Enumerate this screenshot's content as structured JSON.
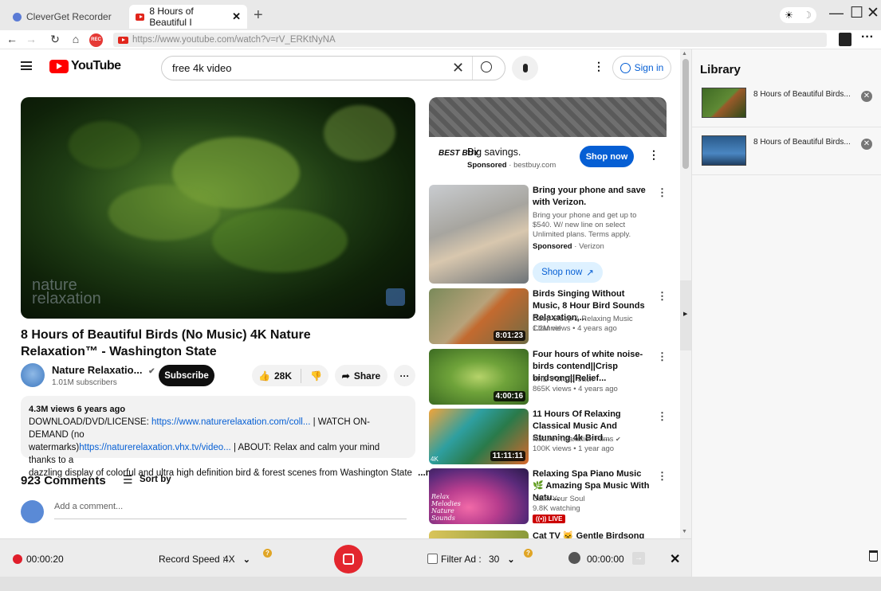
{
  "browser": {
    "tabs": [
      {
        "label": "CleverGet Recorder"
      },
      {
        "label": "8 Hours of Beautiful I"
      }
    ],
    "new_tab": "+",
    "url": "https://www.youtube.com/watch?v=rV_ERKtNyNA",
    "rec_badge": "REC",
    "window_controls": {
      "minimize": "—",
      "maximize": "☐",
      "close": "✕"
    }
  },
  "youtube": {
    "logo": "YouTube",
    "search_query": "free 4k video",
    "signin": "Sign in",
    "video": {
      "title": "8 Hours of Beautiful Birds (No Music) 4K Nature Relaxation™ - Washington State",
      "watermark_line1": "nature",
      "watermark_line2": "relaxation",
      "channel": "Nature Relaxatio...",
      "subscribers": "1.01M subscribers",
      "subscribe": "Subscribe",
      "likes": "28K",
      "share": "Share",
      "description": {
        "stats": "4.3M views  6 years ago",
        "line1_pre": "DOWNLOAD/DVD/LICENSE: ",
        "line1_link": "https://www.naturerelaxation.com/coll...",
        "line1_post": " | WATCH ON-DEMAND (no",
        "line2_pre": "watermarks)",
        "line2_link": "https://naturerelaxation.vhx.tv/video...",
        "line2_post": " | ABOUT: Relax and calm your mind thanks to a",
        "line3": "dazzling display of colorful and ultra high definition bird & forest scenes from Washington State",
        "more": "...more"
      }
    },
    "comments": {
      "count": "923 Comments",
      "sort": "Sort by",
      "placeholder": "Add a comment..."
    },
    "ad": {
      "brand": "BEST BUY",
      "headline": "Big savings.",
      "sponsored": "Sponsored",
      "domain": "bestbuy.com",
      "cta": "Shop now"
    },
    "recommendations": [
      {
        "title": "Bring your phone and save with Verizon.",
        "meta1": "Bring your phone and get up to $540. W/ new line on select Unlimited plans. Terms apply.",
        "sponsored": "Sponsored",
        "advertiser": "Verizon",
        "cta": "Shop now"
      },
      {
        "title": "Birds Singing Without Music, 8 Hour Bird Sounds Relaxation,...",
        "channel": "Deep Sleep & Relaxing Music Channel",
        "stats": "1.2M views  •  4 years ago",
        "duration": "8:01:23"
      },
      {
        "title": "Four hours of white noise-birds contend||Crisp birdsong||Relief...",
        "channel": "THE VOICE -Jack",
        "stats": "865K views  •  4 years ago",
        "duration": "4:00:16"
      },
      {
        "title": "11 Hours Of Relaxing Classical Music And Stunning 4k Bird...",
        "channel": "Nature Relaxation Films",
        "stats": "100K views  •  1 year ago",
        "duration": "11:11:11",
        "badge_4k": "4K"
      },
      {
        "title": "Relaxing Spa Piano Music 🌿 Amazing Spa Music With Natu...",
        "channel": "Calm Your Soul",
        "stats": "9.8K watching",
        "live": "LIVE",
        "thumb_text": "Relax Melodies Nature Sounds"
      },
      {
        "title": "Cat TV 🐱 Gentle Birdsong and"
      }
    ]
  },
  "library": {
    "title": "Library",
    "items": [
      {
        "title": "8 Hours of Beautiful Birds..."
      },
      {
        "title": "8 Hours of Beautiful Birds..."
      }
    ]
  },
  "recorder": {
    "elapsed": "00:00:20",
    "speed_label": "Record Speed :",
    "speed_value": "4X",
    "filter_label": "Filter Ad :",
    "filter_value": "30",
    "timer": "00:00:00",
    "help": "?",
    "close": "✕"
  }
}
